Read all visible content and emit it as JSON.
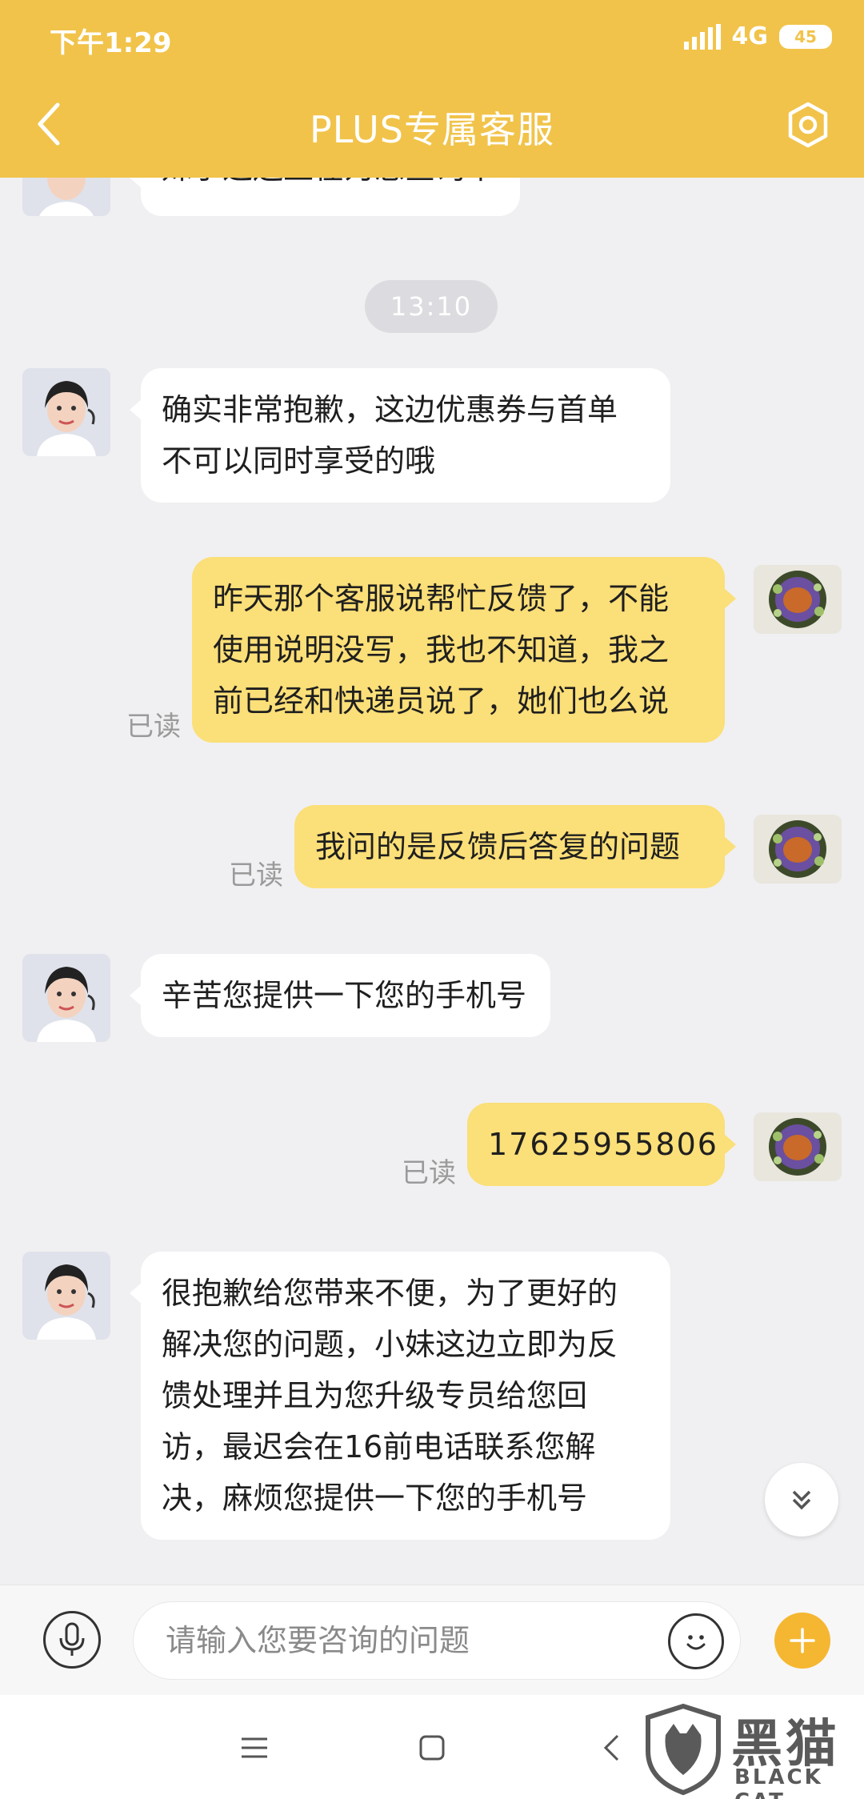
{
  "status_bar": {
    "time": "下午1:29",
    "network": "4G",
    "battery": "45"
  },
  "header": {
    "title": "PLUS专属客服"
  },
  "chat": {
    "timestamp": "13:10",
    "partial_top_message": "妹子这边正在为您查询中",
    "messages": [
      {
        "side": "left",
        "lines": [
          "确实非常抱歉，这边优惠券与首单",
          "不可以同时享受的哦"
        ]
      },
      {
        "side": "right",
        "read_label": "已读",
        "lines": [
          "昨天那个客服说帮忙反馈了，不能",
          "使用说明没写，我也不知道，我之",
          "前已经和快递员说了，她们也么说"
        ]
      },
      {
        "side": "right",
        "read_label": "已读",
        "lines": [
          "我问的是反馈后答复的问题"
        ]
      },
      {
        "side": "left",
        "lines": [
          "辛苦您提供一下您的手机号"
        ]
      },
      {
        "side": "right",
        "read_label": "已读",
        "lines": [
          "17625955806"
        ]
      },
      {
        "side": "left",
        "lines": [
          "很抱歉给您带来不便，为了更好的",
          "解决您的问题，小妹这边立即为反",
          "馈处理并且为您升级专员给您回",
          "访，最迟会在16前电话联系您解",
          "决，麻烦您提供一下您的手机号"
        ]
      }
    ]
  },
  "input": {
    "placeholder": "请输入您要咨询的问题",
    "value": ""
  },
  "watermark": {
    "cn": "黑猫",
    "en": "BLACK CAT"
  },
  "colors": {
    "header": "#f1c34a",
    "user_bubble": "#fbdf78",
    "agent_bubble": "#ffffff",
    "plus_button": "#f5b731"
  }
}
